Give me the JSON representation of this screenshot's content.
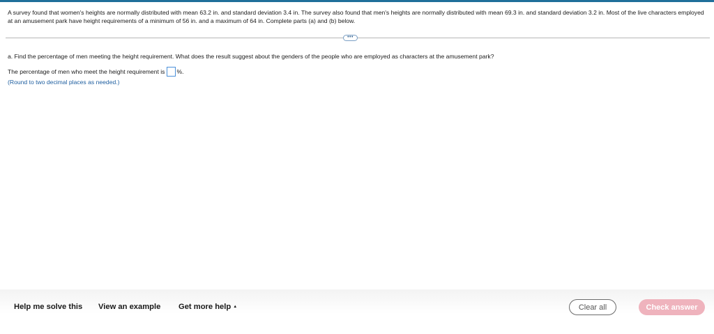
{
  "problem": {
    "text": "A survey found that women's heights are normally distributed with mean 63.2 in. and standard deviation 3.4 in. The survey also found that men's heights are normally distributed with mean 69.3 in. and standard deviation 3.2 in. Most of the live characters employed at an amusement park have height requirements of a minimum of 56 in. and a maximum of 64 in. Complete parts (a) and (b) below."
  },
  "more_button": {
    "label": "•••"
  },
  "part_a": {
    "question": "a. Find the percentage of men meeting the height requirement. What does the result suggest about the genders of the people who are employed as characters at the amusement park?",
    "answer_prefix": "The percentage of men who meet the height requirement is",
    "answer_value": "",
    "answer_suffix": "%.",
    "hint": "(Round to two decimal places as needed.)"
  },
  "footer": {
    "help_solve": "Help me solve this",
    "view_example": "View an example",
    "get_more_help": "Get more help",
    "caret": "▲",
    "clear_all": "Clear all",
    "check_answer": "Check answer"
  },
  "colors": {
    "top_bar": "#1f6f9a",
    "hint_blue": "#1f5fa0",
    "input_border": "#4a90d9",
    "check_button_bg": "#efb3bd"
  }
}
